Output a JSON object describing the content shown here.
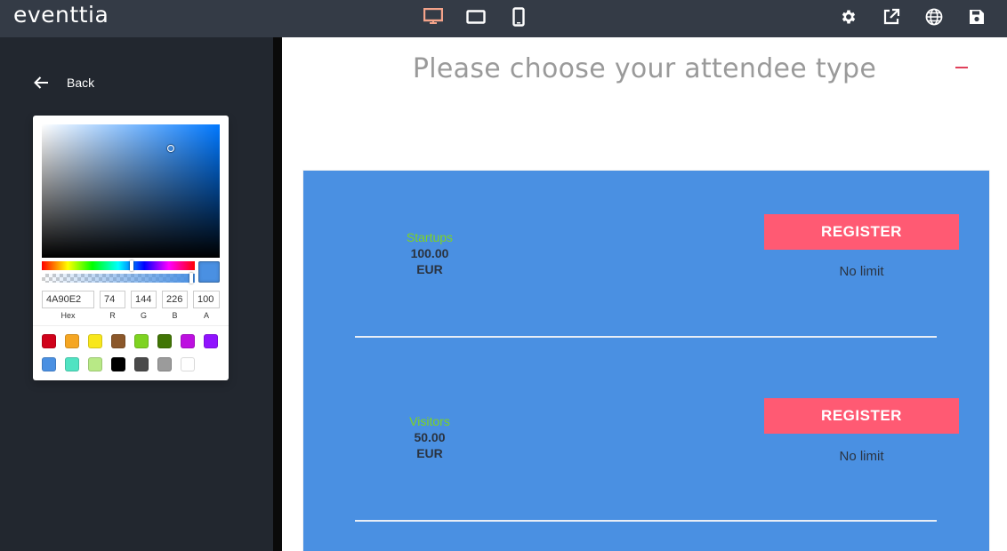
{
  "topbar": {
    "logo_text": "eventtia",
    "device_icons": [
      "desktop-icon",
      "tablet-icon",
      "mobile-icon"
    ],
    "action_icons": [
      "settings-icon",
      "open-external-icon",
      "globe-icon",
      "save-icon"
    ],
    "active_device_color": "#f4a38a"
  },
  "sidebar": {
    "back_label": "Back"
  },
  "color_picker": {
    "hex": "4A90E2",
    "r": "74",
    "g": "144",
    "b": "226",
    "a": "100",
    "labels": {
      "hex": "Hex",
      "r": "R",
      "g": "G",
      "b": "B",
      "a": "A"
    },
    "swatches_row1": [
      "#d0021b",
      "#f5a623",
      "#f8e71c",
      "#8b572a",
      "#7ed321",
      "#417505",
      "#bd10e0",
      "#9013fe"
    ],
    "swatches_row2": [
      "#4a90e2",
      "#50e3c2",
      "#b8e986",
      "#000000",
      "#4a4a4a",
      "#9b9b9b",
      "#ffffff"
    ]
  },
  "main": {
    "title": "Please choose your attendee type",
    "panel_color": "#4a90e2",
    "tickets": [
      {
        "name": "Startups",
        "price": "100.00",
        "currency": "EUR",
        "button_label": "REGISTER",
        "limit": "No limit"
      },
      {
        "name": "Visitors",
        "price": "50.00",
        "currency": "EUR",
        "button_label": "REGISTER",
        "limit": "No limit"
      }
    ]
  }
}
